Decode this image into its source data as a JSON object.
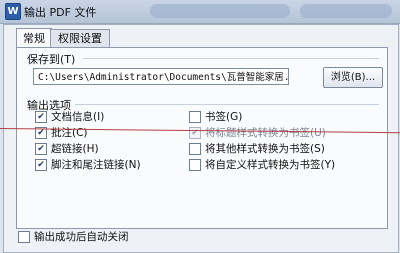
{
  "window": {
    "title": "输出 PDF 文件",
    "icon": "W"
  },
  "tabs": [
    {
      "label": "常规",
      "active": true
    },
    {
      "label": "权限设置",
      "active": false
    }
  ],
  "save_to": {
    "label": "保存到(T)",
    "path": "C:\\Users\\Administrator\\Documents\\瓦普智能家居.pdf",
    "browse_label": "浏览(B)..."
  },
  "output_options": {
    "label": "输出选项",
    "left": [
      {
        "label": "文档信息(I)",
        "checked": true,
        "enabled": true
      },
      {
        "label": "批注(C)",
        "checked": true,
        "enabled": true
      },
      {
        "label": "超链接(H)",
        "checked": true,
        "enabled": true
      },
      {
        "label": "脚注和尾注链接(N)",
        "checked": true,
        "enabled": true
      }
    ],
    "right": [
      {
        "label": "书签(G)",
        "checked": false,
        "enabled": true
      },
      {
        "label": "将标题样式转换为书签(U)",
        "checked": true,
        "enabled": false
      },
      {
        "label": "将其他样式转换为书签(S)",
        "checked": false,
        "enabled": true
      },
      {
        "label": "将自定义样式转换为书签(Y)",
        "checked": false,
        "enabled": true
      }
    ]
  },
  "auto_close": {
    "label": "输出成功后自动关闭",
    "checked": false
  },
  "colors": {
    "annotation_line": "#b54045",
    "title_bar": "#c3d0e2"
  }
}
